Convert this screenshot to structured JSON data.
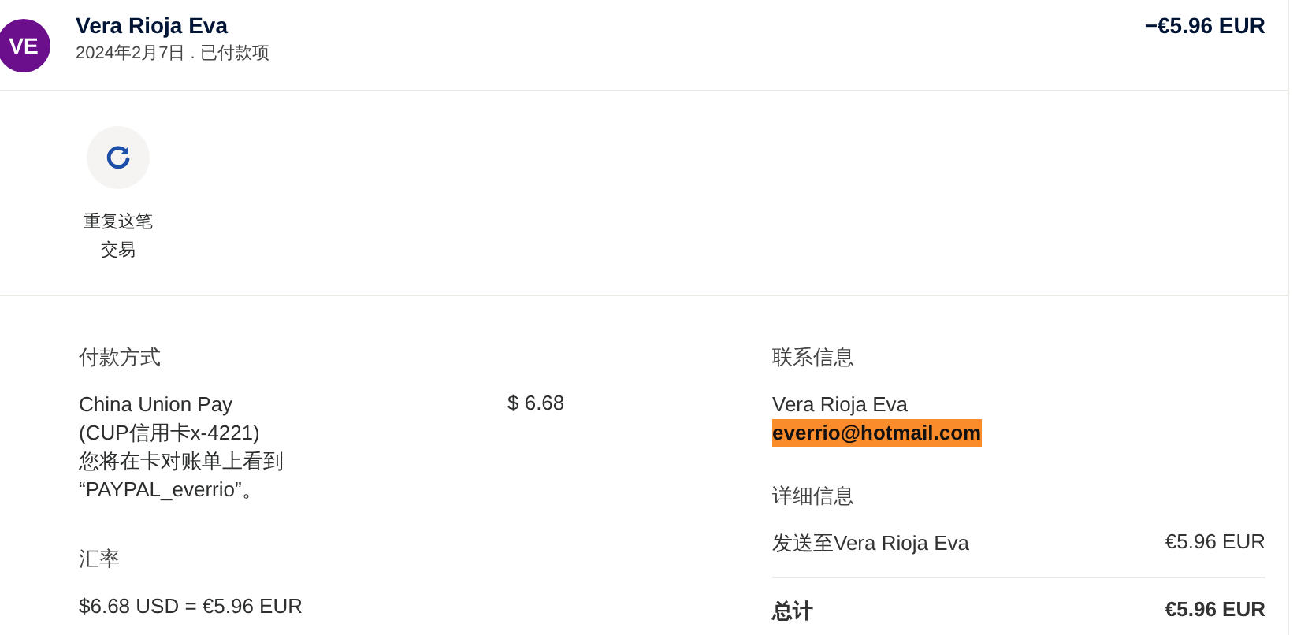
{
  "header": {
    "avatar": "VE",
    "name": "Vera Rioja Eva",
    "subtitle": "2024年2月7日 . 已付款项",
    "amount": "−€5.96 EUR"
  },
  "actions": [
    {
      "label": "重复这笔交易"
    }
  ],
  "payment": {
    "title": "付款方式",
    "method": "China Union Pay",
    "card": "(CUP信用卡x-4221)",
    "note": "您将在卡对账单上看到",
    "descriptor": "“PAYPAL_everrio”。",
    "amount": "$ 6.68"
  },
  "exchange": {
    "title": "汇率",
    "rate": "$6.68 USD = €5.96 EUR"
  },
  "contact": {
    "title": "联系信息",
    "name": "Vera Rioja Eva",
    "email": "everrio@hotmail.com",
    "email_highlighted": true
  },
  "details": {
    "title": "详细信息",
    "rows": [
      {
        "label": "发送至Vera Rioja Eva",
        "value": "€5.96 EUR",
        "kind": "line"
      },
      {
        "label": "总计",
        "value": "€5.96 EUR",
        "kind": "total"
      }
    ]
  }
}
